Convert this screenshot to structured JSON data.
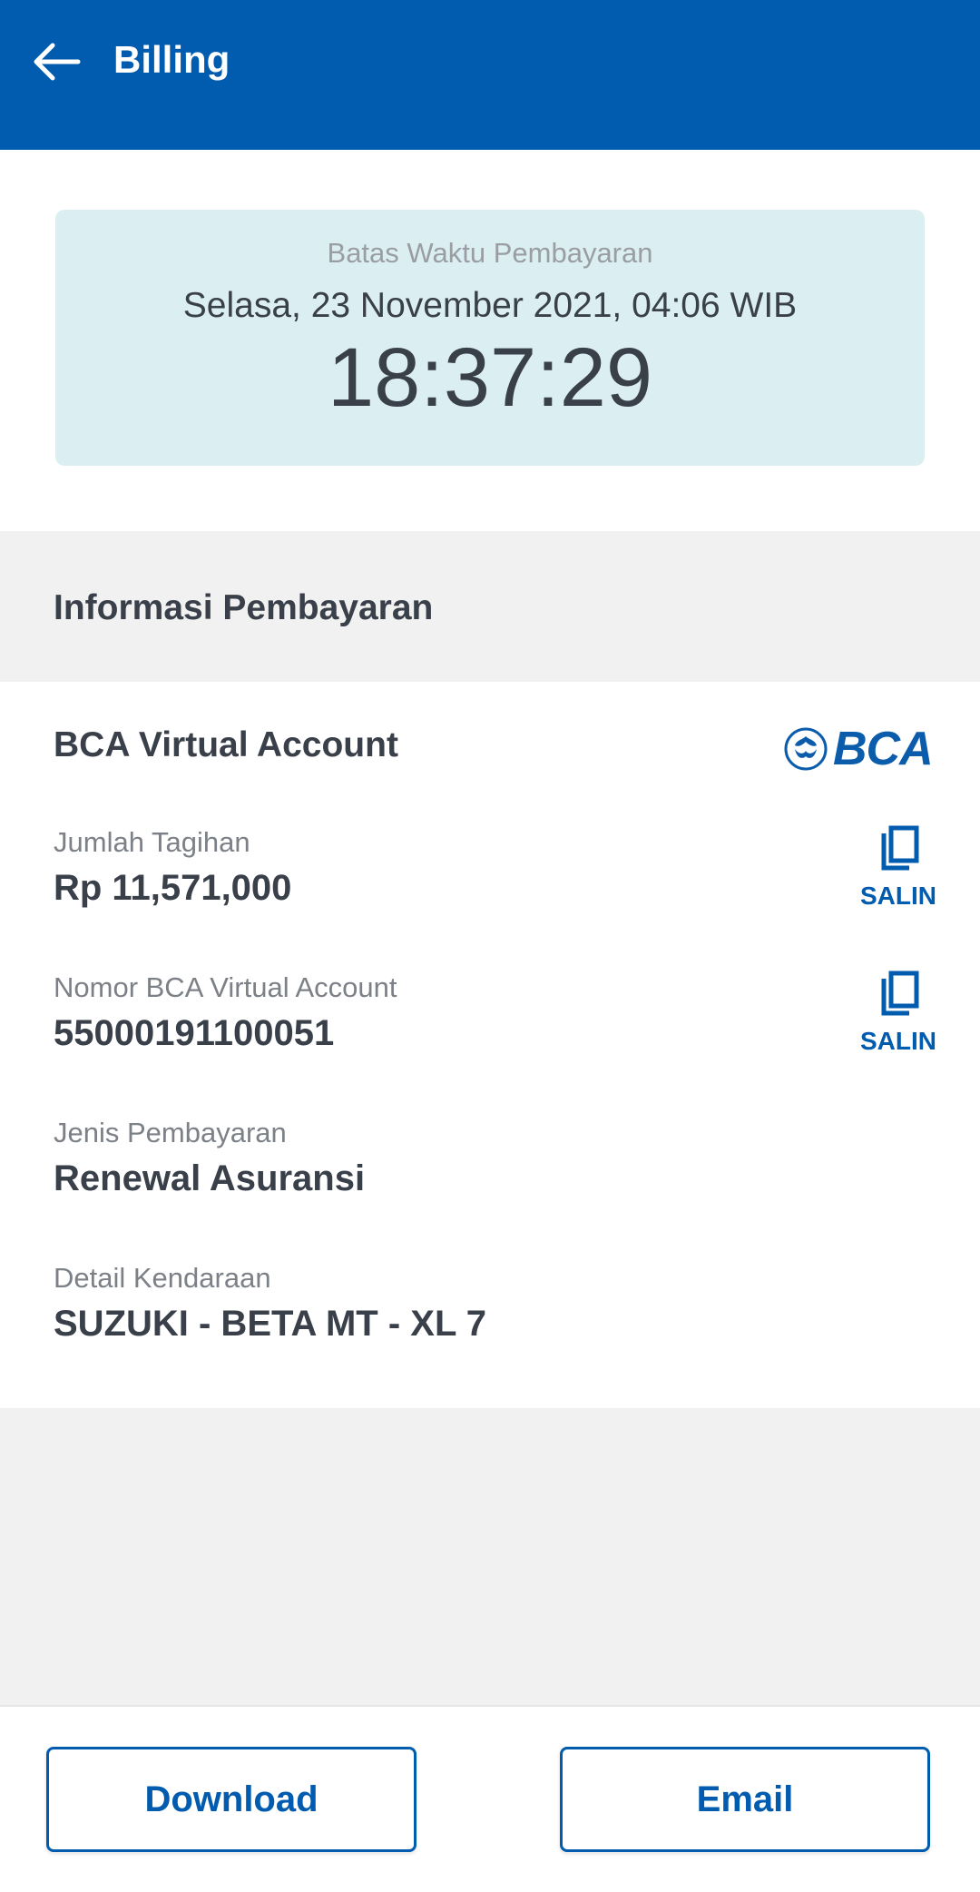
{
  "appbar": {
    "title": "Billing",
    "background_color": "#015bae",
    "back_icon": "arrow-left-icon"
  },
  "deadline": {
    "label": "Batas Waktu Pembayaran",
    "date": "Selasa, 23 November 2021, 04:06 WIB",
    "countdown": "18:37:29"
  },
  "payment_info": {
    "heading": "Informasi Pembayaran",
    "method_title": "BCA Virtual Account",
    "bank_logo_text": "BCA",
    "fields": [
      {
        "label": "Jumlah Tagihan",
        "value": "Rp 11,571,000",
        "copy_label": "SALIN"
      },
      {
        "label": "Nomor BCA Virtual Account",
        "value": "55000191100051",
        "copy_label": "SALIN"
      },
      {
        "label": "Jenis Pembayaran",
        "value": "Renewal Asuransi"
      },
      {
        "label": "Detail Kendaraan",
        "value": "SUZUKI - BETA MT - XL 7"
      }
    ]
  },
  "actions": {
    "download_label": "Download",
    "email_label": "Email"
  },
  "colors": {
    "primary": "#015bae",
    "card_highlight": "#dbeff2",
    "page_background": "#f1f1f2"
  }
}
